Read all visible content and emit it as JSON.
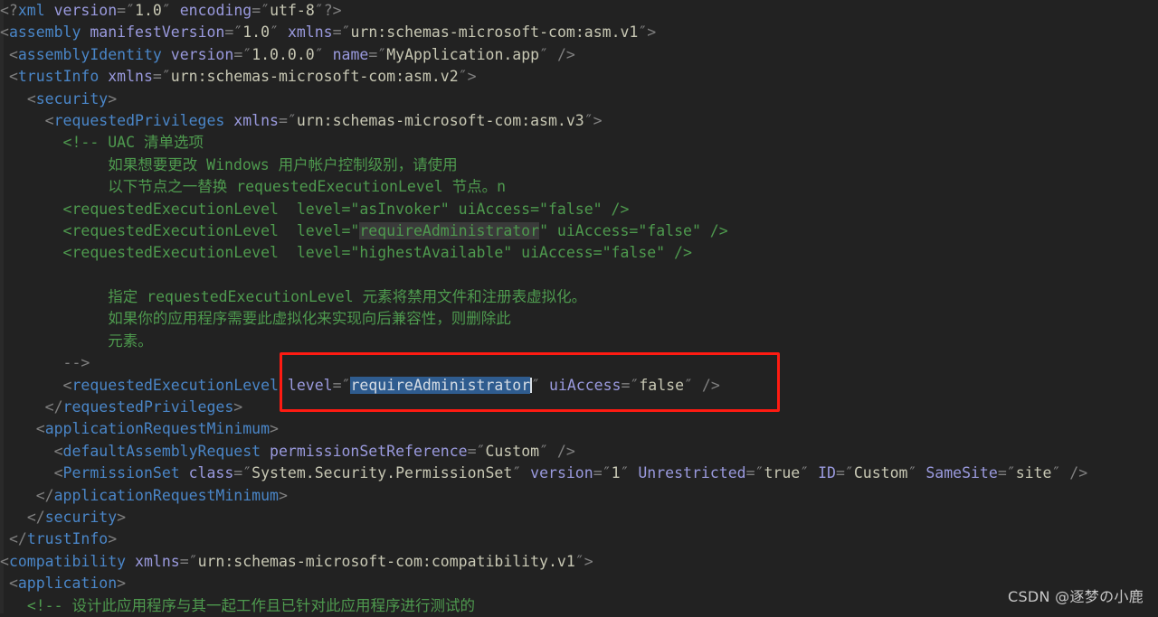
{
  "editor": {
    "background_color": "#222222",
    "default_text_color": "#a9b7c6",
    "colors": {
      "tag": "#4a86c8",
      "attribute": "#9a9ade",
      "value": "#c8c8b4",
      "punctuation": "#808080",
      "comment": "#4e9a4e",
      "selection": "#2f5c8f",
      "soft_highlight": "#3a3a3a",
      "annotation_box": "#fe1b12"
    },
    "lines": [
      {
        "n": 1,
        "indent": 0,
        "type": "prolog",
        "text": "<?xml version=\"1.0\" encoding=\"utf-8\"?>"
      },
      {
        "n": 2,
        "indent": 0,
        "type": "tag",
        "text": "<assembly manifestVersion=\"1.0\" xmlns=\"urn:schemas-microsoft-com:asm.v1\">"
      },
      {
        "n": 3,
        "indent": 1,
        "type": "tag",
        "text": "<assemblyIdentity version=\"1.0.0.0\" name=\"MyApplication.app\" />"
      },
      {
        "n": 4,
        "indent": 1,
        "type": "tag",
        "text": "<trustInfo xmlns=\"urn:schemas-microsoft-com:asm.v2\">"
      },
      {
        "n": 5,
        "indent": 2,
        "type": "tag",
        "text": "<security>"
      },
      {
        "n": 6,
        "indent": 3,
        "type": "tag",
        "text": "<requestedPrivileges xmlns=\"urn:schemas-microsoft-com:asm.v3\">"
      },
      {
        "n": 7,
        "indent": 4,
        "type": "comment",
        "text": "<!-- UAC 清单选项"
      },
      {
        "n": 8,
        "indent": 6,
        "type": "comment",
        "text": "如果想要更改 Windows 用户帐户控制级别，请使用"
      },
      {
        "n": 9,
        "indent": 6,
        "type": "comment",
        "text": "以下节点之一替换 requestedExecutionLevel 节点。n"
      },
      {
        "n": 10,
        "indent": 4,
        "type": "comment",
        "text": "<requestedExecutionLevel  level=\"asInvoker\" uiAccess=\"false\" />"
      },
      {
        "n": 11,
        "indent": 4,
        "type": "comment",
        "text": "<requestedExecutionLevel  level=\"requireAdministrator\" uiAccess=\"false\" />"
      },
      {
        "n": 12,
        "indent": 4,
        "type": "comment",
        "text": "<requestedExecutionLevel  level=\"highestAvailable\" uiAccess=\"false\" />"
      },
      {
        "n": 13,
        "indent": 0,
        "type": "blank",
        "text": ""
      },
      {
        "n": 14,
        "indent": 6,
        "type": "comment",
        "text": "指定 requestedExecutionLevel 元素将禁用文件和注册表虚拟化。"
      },
      {
        "n": 15,
        "indent": 6,
        "type": "comment",
        "text": "如果你的应用程序需要此虚拟化来实现向后兼容性，则删除此"
      },
      {
        "n": 16,
        "indent": 6,
        "type": "comment",
        "text": "元素。"
      },
      {
        "n": 17,
        "indent": 4,
        "type": "punct",
        "text": "-->"
      },
      {
        "n": 18,
        "indent": 4,
        "type": "tag",
        "text": "<requestedExecutionLevel level=\"requireAdministrator\" uiAccess=\"false\" />"
      },
      {
        "n": 19,
        "indent": 3,
        "type": "tag",
        "text": "</requestedPrivileges>"
      },
      {
        "n": 20,
        "indent": 2,
        "type": "tag",
        "text": "<applicationRequestMinimum>"
      },
      {
        "n": 21,
        "indent": 3,
        "type": "tag",
        "text": "<defaultAssemblyRequest permissionSetReference=\"Custom\" />"
      },
      {
        "n": 22,
        "indent": 3,
        "type": "tag",
        "text": "<PermissionSet class=\"System.Security.PermissionSet\" version=\"1\" Unrestricted=\"true\" ID=\"Custom\" SameSite=\"site\" />"
      },
      {
        "n": 23,
        "indent": 2,
        "type": "tag",
        "text": "</applicationRequestMinimum>"
      },
      {
        "n": 24,
        "indent": 2,
        "type": "tag",
        "text": "</security>"
      },
      {
        "n": 25,
        "indent": 1,
        "type": "tag",
        "text": "</trustInfo>"
      },
      {
        "n": 26,
        "indent": 0,
        "type": "tag",
        "text": "<compatibility xmlns=\"urn:schemas-microsoft-com:compatibility.v1\">"
      },
      {
        "n": 27,
        "indent": 1,
        "type": "tag",
        "text": "<application>"
      },
      {
        "n": 28,
        "indent": 2,
        "type": "comment",
        "text": "<!-- 设计此应用程序与其一起工作且已针对此应用程序进行测试的"
      }
    ],
    "tokens": {
      "l1": [
        {
          "c": "punct",
          "s": "<?"
        },
        {
          "c": "tag",
          "s": "xml"
        },
        {
          "c": "plain",
          "s": " "
        },
        {
          "c": "attr",
          "s": "version"
        },
        {
          "c": "punct",
          "s": "=\""
        },
        {
          "c": "val",
          "s": "1.0"
        },
        {
          "c": "punct",
          "s": "\""
        },
        {
          "c": "plain",
          "s": " "
        },
        {
          "c": "attr",
          "s": "encoding"
        },
        {
          "c": "punct",
          "s": "=\""
        },
        {
          "c": "val",
          "s": "utf-8"
        },
        {
          "c": "punct",
          "s": "\"?>"
        }
      ],
      "l2": [
        {
          "c": "punct",
          "s": "<"
        },
        {
          "c": "tag",
          "s": "assembly"
        },
        {
          "c": "plain",
          "s": " "
        },
        {
          "c": "attr",
          "s": "manifestVersion"
        },
        {
          "c": "punct",
          "s": "=\""
        },
        {
          "c": "val",
          "s": "1.0"
        },
        {
          "c": "punct",
          "s": "\""
        },
        {
          "c": "plain",
          "s": " "
        },
        {
          "c": "attr",
          "s": "xmlns"
        },
        {
          "c": "punct",
          "s": "=\""
        },
        {
          "c": "val",
          "s": "urn:schemas-microsoft-com:asm.v1"
        },
        {
          "c": "punct",
          "s": "\">"
        }
      ],
      "l3": [
        {
          "c": "punct",
          "s": "<"
        },
        {
          "c": "tag",
          "s": "assemblyIdentity"
        },
        {
          "c": "plain",
          "s": " "
        },
        {
          "c": "attr",
          "s": "version"
        },
        {
          "c": "punct",
          "s": "=\""
        },
        {
          "c": "val",
          "s": "1.0.0.0"
        },
        {
          "c": "punct",
          "s": "\""
        },
        {
          "c": "plain",
          "s": " "
        },
        {
          "c": "attr",
          "s": "name"
        },
        {
          "c": "punct",
          "s": "=\""
        },
        {
          "c": "val",
          "s": "MyApplication.app"
        },
        {
          "c": "punct",
          "s": "\" />"
        }
      ],
      "l4": [
        {
          "c": "punct",
          "s": "<"
        },
        {
          "c": "tag",
          "s": "trustInfo"
        },
        {
          "c": "plain",
          "s": " "
        },
        {
          "c": "attr",
          "s": "xmlns"
        },
        {
          "c": "punct",
          "s": "=\""
        },
        {
          "c": "val",
          "s": "urn:schemas-microsoft-com:asm.v2"
        },
        {
          "c": "punct",
          "s": "\">"
        }
      ],
      "l5": [
        {
          "c": "punct",
          "s": "<"
        },
        {
          "c": "tag",
          "s": "security"
        },
        {
          "c": "punct",
          "s": ">"
        }
      ],
      "l6": [
        {
          "c": "punct",
          "s": "<"
        },
        {
          "c": "tag",
          "s": "requestedPrivileges"
        },
        {
          "c": "plain",
          "s": " "
        },
        {
          "c": "attr",
          "s": "xmlns"
        },
        {
          "c": "punct",
          "s": "=\""
        },
        {
          "c": "val",
          "s": "urn:schemas-microsoft-com:asm.v3"
        },
        {
          "c": "punct",
          "s": "\">"
        }
      ],
      "l18": [
        {
          "c": "punct",
          "s": "<"
        },
        {
          "c": "tag",
          "s": "requestedExecutionLevel"
        },
        {
          "c": "plain",
          "s": " "
        },
        {
          "c": "attr",
          "s": "level"
        },
        {
          "c": "punct",
          "s": "=\""
        },
        {
          "c": "sel",
          "s": "requireAdministrator"
        },
        {
          "c": "punct",
          "s": "\""
        },
        {
          "c": "plain",
          "s": " "
        },
        {
          "c": "attr",
          "s": "uiAccess"
        },
        {
          "c": "punct",
          "s": "=\""
        },
        {
          "c": "val",
          "s": "false"
        },
        {
          "c": "punct",
          "s": "\" />"
        }
      ],
      "l19": [
        {
          "c": "punct",
          "s": "</"
        },
        {
          "c": "tag",
          "s": "requestedPrivileges"
        },
        {
          "c": "punct",
          "s": ">"
        }
      ],
      "l20": [
        {
          "c": "punct",
          "s": "<"
        },
        {
          "c": "tag",
          "s": "applicationRequestMinimum"
        },
        {
          "c": "punct",
          "s": ">"
        }
      ],
      "l21": [
        {
          "c": "punct",
          "s": "<"
        },
        {
          "c": "tag",
          "s": "defaultAssemblyRequest"
        },
        {
          "c": "plain",
          "s": " "
        },
        {
          "c": "attr",
          "s": "permissionSetReference"
        },
        {
          "c": "punct",
          "s": "=\""
        },
        {
          "c": "val",
          "s": "Custom"
        },
        {
          "c": "punct",
          "s": "\" />"
        }
      ],
      "l22": [
        {
          "c": "punct",
          "s": "<"
        },
        {
          "c": "tag",
          "s": "PermissionSet"
        },
        {
          "c": "plain",
          "s": " "
        },
        {
          "c": "attr",
          "s": "class"
        },
        {
          "c": "punct",
          "s": "=\""
        },
        {
          "c": "val",
          "s": "System.Security.PermissionSet"
        },
        {
          "c": "punct",
          "s": "\""
        },
        {
          "c": "plain",
          "s": " "
        },
        {
          "c": "attr",
          "s": "version"
        },
        {
          "c": "punct",
          "s": "=\""
        },
        {
          "c": "val",
          "s": "1"
        },
        {
          "c": "punct",
          "s": "\""
        },
        {
          "c": "plain",
          "s": " "
        },
        {
          "c": "attr",
          "s": "Unrestricted"
        },
        {
          "c": "punct",
          "s": "=\""
        },
        {
          "c": "val",
          "s": "true"
        },
        {
          "c": "punct",
          "s": "\""
        },
        {
          "c": "plain",
          "s": " "
        },
        {
          "c": "attr",
          "s": "ID"
        },
        {
          "c": "punct",
          "s": "=\""
        },
        {
          "c": "val",
          "s": "Custom"
        },
        {
          "c": "punct",
          "s": "\""
        },
        {
          "c": "plain",
          "s": " "
        },
        {
          "c": "attr",
          "s": "SameSite"
        },
        {
          "c": "punct",
          "s": "=\""
        },
        {
          "c": "val",
          "s": "site"
        },
        {
          "c": "punct",
          "s": "\" />"
        }
      ],
      "l23": [
        {
          "c": "punct",
          "s": "</"
        },
        {
          "c": "tag",
          "s": "applicationRequestMinimum"
        },
        {
          "c": "punct",
          "s": ">"
        }
      ],
      "l24": [
        {
          "c": "punct",
          "s": "</"
        },
        {
          "c": "tag",
          "s": "security"
        },
        {
          "c": "punct",
          "s": ">"
        }
      ],
      "l25": [
        {
          "c": "punct",
          "s": "</"
        },
        {
          "c": "tag",
          "s": "trustInfo"
        },
        {
          "c": "punct",
          "s": ">"
        }
      ],
      "l26": [
        {
          "c": "punct",
          "s": "<"
        },
        {
          "c": "tag",
          "s": "compatibility"
        },
        {
          "c": "plain",
          "s": " "
        },
        {
          "c": "attr",
          "s": "xmlns"
        },
        {
          "c": "punct",
          "s": "=\""
        },
        {
          "c": "val",
          "s": "urn:schemas-microsoft-com:compatibility.v1"
        },
        {
          "c": "punct",
          "s": "\">"
        }
      ],
      "l27": [
        {
          "c": "punct",
          "s": "<"
        },
        {
          "c": "tag",
          "s": "application"
        },
        {
          "c": "punct",
          "s": ">"
        }
      ]
    },
    "comment_lines": {
      "l7": "<!-- UAC 清单选项",
      "l8": "如果想要更改 Windows 用户帐户控制级别，请使用",
      "l9": "以下节点之一替换 requestedExecutionLevel 节点。n",
      "l10_pre": "<requestedExecutionLevel  level=\"asInvoker\" uiAccess=\"false\" />",
      "l11_a": "<requestedExecutionLevel  level=\"",
      "l11_hl": "requireAdministrator",
      "l11_b": "\" uiAccess=\"false\" />",
      "l12": "<requestedExecutionLevel  level=\"highestAvailable\" uiAccess=\"false\" />",
      "l14": "指定 requestedExecutionLevel 元素将禁用文件和注册表虚拟化。",
      "l15": "如果你的应用程序需要此虚拟化来实现向后兼容性，则删除此",
      "l16": "元素。",
      "l17": "-->",
      "l28": "<!-- 设计此应用程序与其一起工作且已针对此应用程序进行测试的"
    }
  },
  "annotation": {
    "shape": "rectangle",
    "color": "#fe1b12",
    "target_line": 18,
    "target_text": "level=\"requireAdministrator\" uiAccess=\"false\" />"
  },
  "watermark": {
    "text": "CSDN @逐梦の小鹿"
  }
}
